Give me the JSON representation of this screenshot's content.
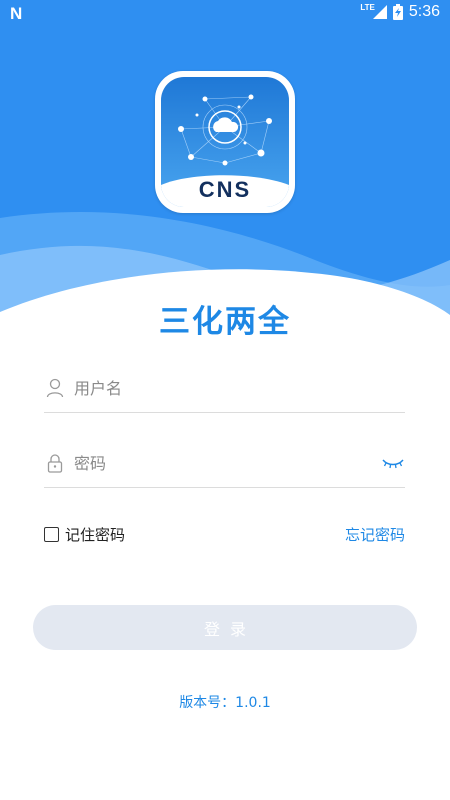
{
  "status_bar": {
    "left_icon": "notification-n-icon",
    "network": "LTE",
    "time": "5:36"
  },
  "logo": {
    "text": "CNS",
    "icon": "cloud-network-icon"
  },
  "app_title": "三化两全",
  "form": {
    "username_placeholder": "用户名",
    "username_value": "",
    "password_placeholder": "密码",
    "password_value": "",
    "remember_label": "记住密码",
    "remember_checked": false,
    "forgot_label": "忘记密码",
    "login_label": "登录"
  },
  "version_text": "版本号：1.0.1",
  "colors": {
    "primary_blue": "#1e88e5",
    "header_blue": "#2f8ff1",
    "button_bg": "#e3e8f1"
  }
}
